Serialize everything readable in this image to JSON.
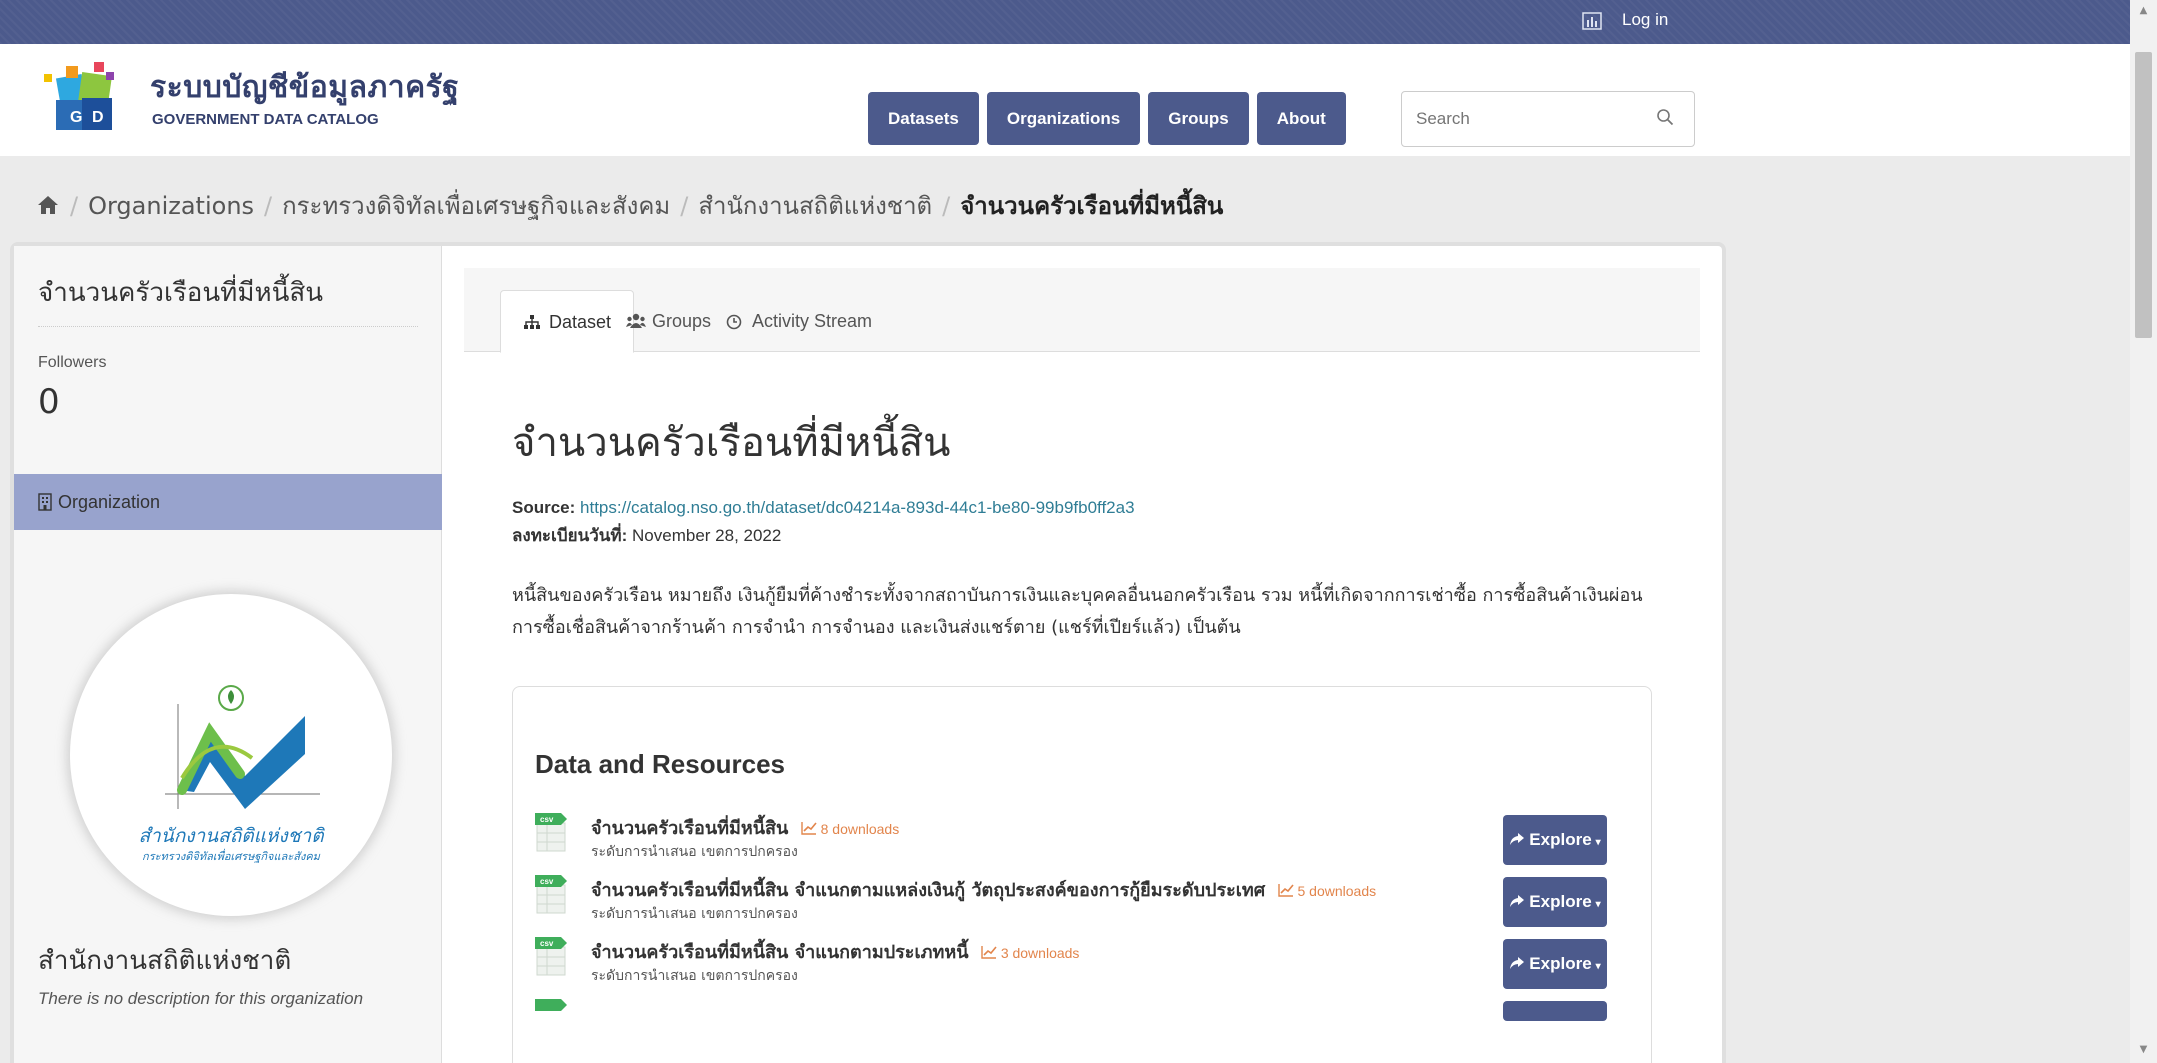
{
  "topbar": {
    "stats_icon": "bar-chart-icon",
    "login_label": "Log in"
  },
  "header": {
    "logo_title": "ระบบบัญชีข้อมูลภาครัฐ",
    "logo_subtitle": "GOVERNMENT DATA CATALOG",
    "logo_letters": [
      "G",
      "D"
    ],
    "nav": [
      "Datasets",
      "Organizations",
      "Groups",
      "About"
    ],
    "search_placeholder": "Search",
    "accent_color": "#4c5a8c"
  },
  "breadcrumb": {
    "items": [
      "Organizations",
      "กระทรวงดิจิทัลเพื่อเศรษฐกิจและสังคม",
      "สำนักงานสถิติแห่งชาติ"
    ],
    "current": "จำนวนครัวเรือนที่มีหนี้สิน"
  },
  "sidebar": {
    "title": "จำนวนครัวเรือนที่มีหนี้สิน",
    "followers_label": "Followers",
    "followers_count": "0",
    "org_heading": "Organization",
    "org_logo_text_1": "สำนักงานสถิติแห่งชาติ",
    "org_logo_text_2": "กระทรวงดิจิทัลเพื่อเศรษฐกิจและสังคม",
    "org_name": "สำนักงานสถิติแห่งชาติ",
    "org_description": "There is no description for this organization",
    "highlight_color": "#98a3cd"
  },
  "tabs": [
    "Dataset",
    "Groups",
    "Activity Stream"
  ],
  "dataset": {
    "title": "จำนวนครัวเรือนที่มีหนี้สิน",
    "source_label": "Source:",
    "source_url": "https://catalog.nso.go.th/dataset/dc04214a-893d-44c1-be80-99b9fb0ff2a3",
    "registered_label": "ลงทะเบียนวันที่:",
    "registered_date": "November 28, 2022",
    "notes": "หนี้สินของครัวเรือน หมายถึง เงินกู้ยืมที่ค้างชำระทั้งจากสถาบันการเงินและบุคคลอื่นนอกครัวเรือน รวม หนี้ที่เกิดจากการเช่าซื้อ การซื้อสินค้าเงินผ่อน การซื้อเชื่อสินค้าจากร้านค้า การจำนำ การจำนอง และเงินส่งแชร์ตาย (แชร์ที่เปียร์แล้ว) เป็นต้น"
  },
  "resources": {
    "heading": "Data and Resources",
    "format_label": "csv",
    "explore_label": "Explore",
    "items": [
      {
        "name": "จำนวนครัวเรือนที่มีหนี้สิน",
        "downloads": "8 downloads",
        "desc": "ระดับการนำเสนอ เขตการปกครอง"
      },
      {
        "name": "จำนวนครัวเรือนที่มีหนี้สิน จำแนกตามแหล่งเงินกู้ วัตถุประสงค์ของการกู้ยืมระดับประเทศ",
        "downloads": "5 downloads",
        "desc": "ระดับการนำเสนอ เขตการปกครอง"
      },
      {
        "name": "จำนวนครัวเรือนที่มีหนี้สิน จำแนกตามประเภทหนี้",
        "downloads": "3 downloads",
        "desc": "ระดับการนำเสนอ เขตการปกครอง"
      }
    ]
  }
}
